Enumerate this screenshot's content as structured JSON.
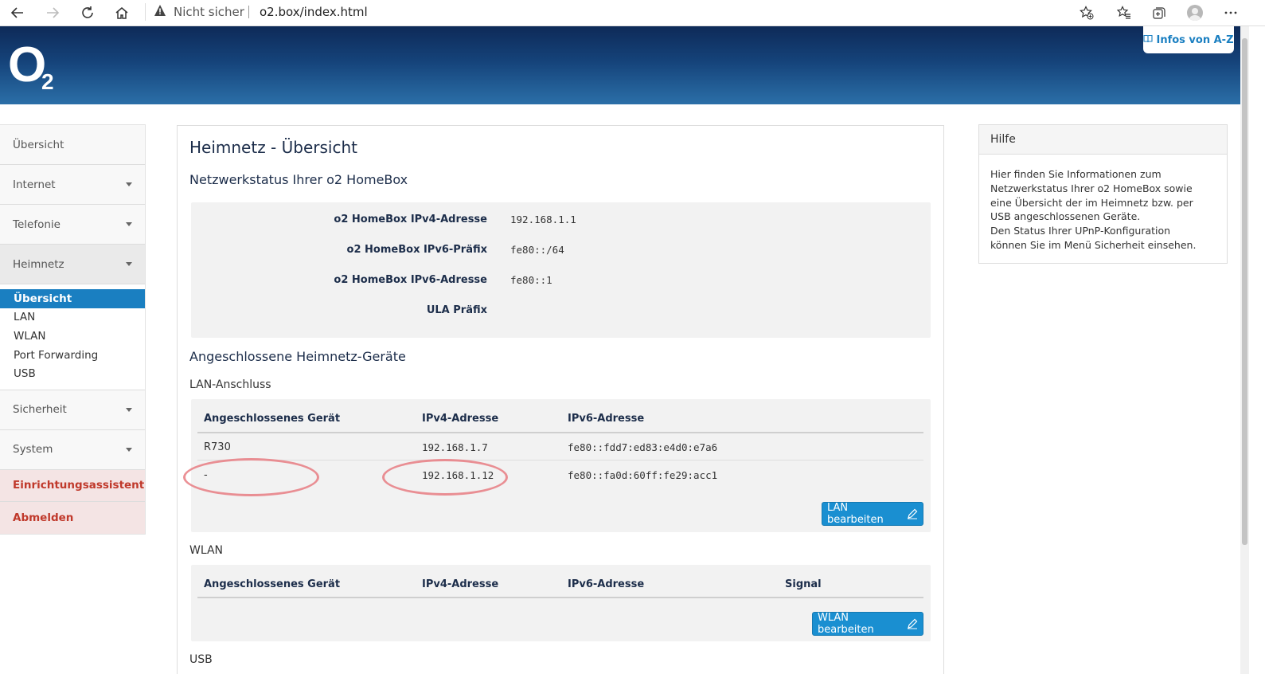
{
  "browser": {
    "insecure_label": "Nicht sicher",
    "url": "o2.box/index.html"
  },
  "header": {
    "logo_o": "O",
    "logo_2": "2",
    "infos_label": "Infos von A-Z"
  },
  "sidebar": {
    "items": [
      {
        "label": "Übersicht"
      },
      {
        "label": "Internet"
      },
      {
        "label": "Telefonie"
      },
      {
        "label": "Heimnetz"
      }
    ],
    "subitems": [
      {
        "label": "Übersicht"
      },
      {
        "label": "LAN"
      },
      {
        "label": "WLAN"
      },
      {
        "label": "Port Forwarding"
      },
      {
        "label": "USB"
      }
    ],
    "items_after": [
      {
        "label": "Sicherheit"
      },
      {
        "label": "System"
      }
    ],
    "wizard": "Einrichtungsassistent",
    "logout": "Abmelden"
  },
  "main": {
    "title": "Heimnetz - Übersicht",
    "status_heading": "Netzwerkstatus Ihrer o2 HomeBox",
    "status_rows": [
      {
        "label": "o2 HomeBox IPv4-Adresse",
        "value": "192.168.1.1"
      },
      {
        "label": "o2 HomeBox IPv6-Präfix",
        "value": "fe80::/64"
      },
      {
        "label": "o2 HomeBox IPv6-Adresse",
        "value": "fe80::1"
      },
      {
        "label": "ULA Präfix",
        "value": ""
      }
    ],
    "devices_heading": "Angeschlossene Heimnetz-Geräte",
    "lan": {
      "heading": "LAN-Anschluss",
      "columns": [
        "Angeschlossenes Gerät",
        "IPv4-Adresse",
        "IPv6-Adresse"
      ],
      "rows": [
        {
          "device": "R730",
          "ipv4": "192.168.1.7",
          "ipv6": "fe80::fdd7:ed83:e4d0:e7a6"
        },
        {
          "device": "-",
          "ipv4": "192.168.1.12",
          "ipv6": "fe80::fa0d:60ff:fe29:acc1"
        }
      ],
      "button": "LAN bearbeiten"
    },
    "wlan": {
      "heading": "WLAN",
      "columns": [
        "Angeschlossenes Gerät",
        "IPv4-Adresse",
        "IPv6-Adresse",
        "Signal"
      ],
      "button": "WLAN bearbeiten"
    },
    "usb": {
      "heading": "USB"
    }
  },
  "help": {
    "title": "Hilfe",
    "lines": [
      "Hier finden Sie Informationen zum",
      "Netzwerkstatus Ihrer o2 HomeBox sowie",
      "eine Übersicht der im Heimnetz bzw. per",
      "USB angeschlossenen Geräte.",
      "Den Status Ihrer UPnP-Konfiguration",
      "können Sie im Menü Sicherheit einsehen."
    ]
  },
  "colors": {
    "accent": "#1a7fc1",
    "button": "#1a8fd1",
    "header_dark": "#0e2a58",
    "annotation": "#e87d82",
    "danger_text": "#c0392b"
  }
}
